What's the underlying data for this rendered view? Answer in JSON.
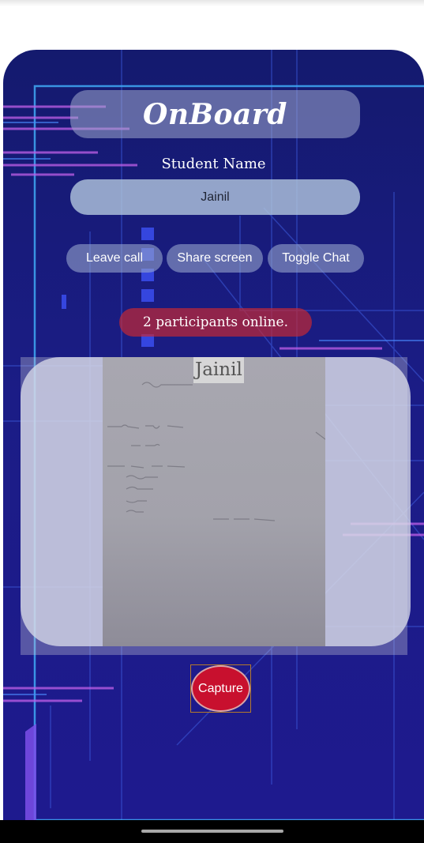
{
  "app": {
    "title": "OnBoard",
    "student_name_label": "Student Name",
    "student_name_value": "Jainil"
  },
  "controls": {
    "leave_call": "Leave call",
    "share_screen": "Share screen",
    "toggle_chat": "Toggle Chat"
  },
  "status": {
    "participants_text": "2 participants online."
  },
  "video": {
    "participant_name": "Jainil"
  },
  "capture": {
    "label": "Capture"
  },
  "colors": {
    "background_top": "#141a6e",
    "background_bottom": "#1e1a8e",
    "accent_cyan": "#3fa9f5",
    "accent_magenta": "#c05fe8",
    "badge_red": "#c8102e"
  }
}
